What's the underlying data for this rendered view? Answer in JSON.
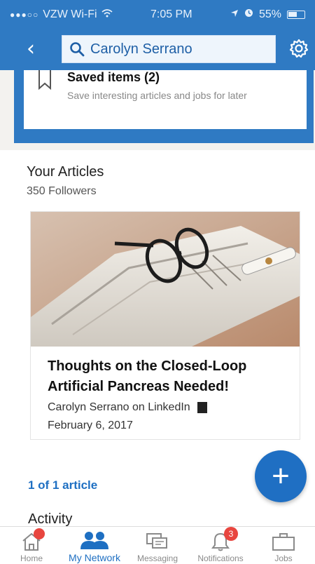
{
  "status_bar": {
    "signal": "●●●○○",
    "carrier": "VZW Wi-Fi",
    "time": "7:05 PM",
    "battery": "55%"
  },
  "header": {
    "search_value": "Carolyn Serrano",
    "back_glyph": "‹"
  },
  "saved": {
    "title": "Saved items (2)",
    "description": "Save interesting articles and jobs for later"
  },
  "articles": {
    "section_title": "Your Articles",
    "followers": "350 Followers",
    "items": [
      {
        "title": "Thoughts on the Closed-Loop Artificial Pancreas Needed!",
        "byline": "Carolyn Serrano on LinkedIn",
        "date": "February 6, 2017"
      }
    ],
    "count_label": "1 of 1 article"
  },
  "activity": {
    "title": "Activity"
  },
  "fab": {
    "glyph": "+"
  },
  "tabbar": {
    "tabs": [
      {
        "label": "Home",
        "icon": "home-icon",
        "badge": ""
      },
      {
        "label": "My Network",
        "icon": "people-icon",
        "badge": ""
      },
      {
        "label": "Messaging",
        "icon": "messaging-icon",
        "badge": ""
      },
      {
        "label": "Notifications",
        "icon": "bell-icon",
        "badge": "3"
      },
      {
        "label": "Jobs",
        "icon": "briefcase-icon",
        "badge": ""
      }
    ]
  },
  "colors": {
    "brand": "#2f7ac3",
    "link": "#1e6fc2",
    "badge": "#e8463f"
  }
}
